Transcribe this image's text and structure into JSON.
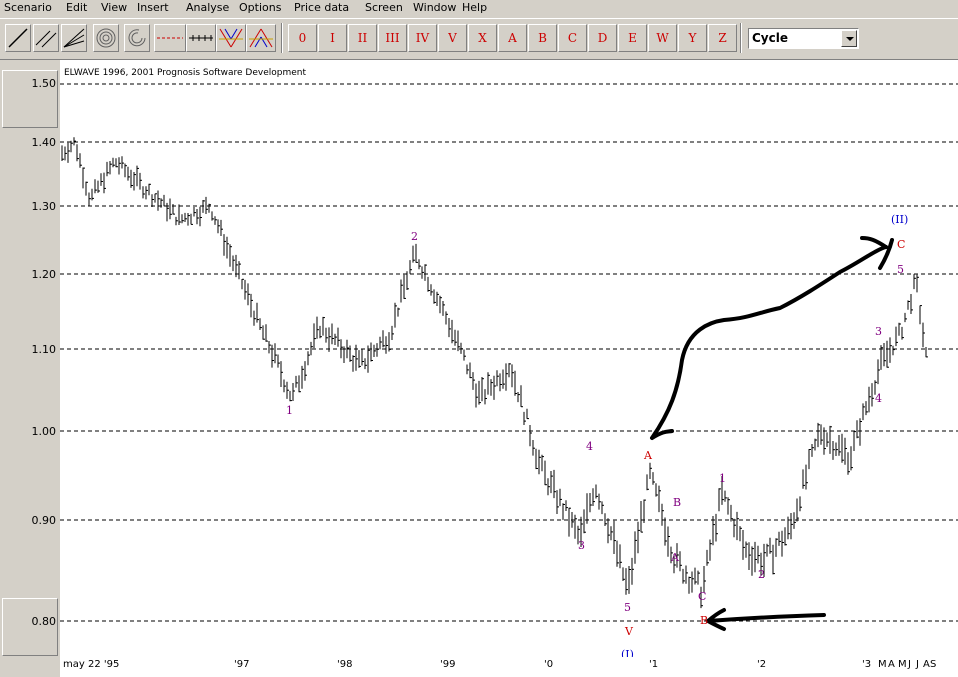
{
  "menu": [
    "Scenario",
    "Edit",
    "View",
    "Insert",
    "Analyse",
    "Options",
    "Price data",
    "Screen",
    "Window",
    "Help"
  ],
  "toolbar": {
    "wave_buttons": [
      "0",
      "I",
      "II",
      "III",
      "IV",
      "V",
      "X",
      "A",
      "B",
      "C",
      "D",
      "E",
      "W",
      "Y",
      "Z"
    ],
    "degree_select": "Cycle"
  },
  "chart": {
    "copyright": "ELWAVE   1996, 2001 Prognosis Software Development",
    "y_ticks": [
      "1.50",
      "1.40",
      "1.30",
      "1.20",
      "1.10",
      "1.00",
      "0.90",
      "0.80"
    ],
    "x_ticks": [
      "may 22 '95",
      "'97",
      "'98",
      "'99",
      "'0",
      "'1",
      "'2",
      "'3",
      "M",
      "A",
      "M",
      "J",
      "J",
      "A",
      "S"
    ],
    "wave_labels": {
      "w1": "1",
      "w2": "2",
      "w3a": "3",
      "w4a": "4",
      "w5a": "5",
      "V": "V",
      "I_paren": "(I)",
      "A": "A",
      "B_circ": "B",
      "A_circ": "A",
      "C_circ": "C",
      "B": "B",
      "c1": "1",
      "c2": "2",
      "c3": "3",
      "c4": "4",
      "c5": "5",
      "C": "C",
      "II_paren": "(II)"
    },
    "colors": {
      "circled": "#800080",
      "red": "#cc0000",
      "blue": "#0000cc",
      "annotation": "#000000"
    }
  },
  "chart_data": {
    "type": "bar",
    "title": "",
    "ylim": [
      0.77,
      1.53
    ],
    "grid": "horizontal dashed",
    "approx_path": [
      [
        0,
        1.38
      ],
      [
        15,
        1.4
      ],
      [
        30,
        1.31
      ],
      [
        55,
        1.37
      ],
      [
        90,
        1.32
      ],
      [
        120,
        1.28
      ],
      [
        150,
        1.3
      ],
      [
        175,
        1.21
      ],
      [
        200,
        1.13
      ],
      [
        232,
        1.04
      ],
      [
        260,
        1.13
      ],
      [
        300,
        1.08
      ],
      [
        330,
        1.12
      ],
      [
        355,
        1.23
      ],
      [
        380,
        1.16
      ],
      [
        420,
        1.04
      ],
      [
        450,
        1.08
      ],
      [
        480,
        0.96
      ],
      [
        520,
        0.88
      ],
      [
        535,
        0.94
      ],
      [
        568,
        0.83
      ],
      [
        590,
        0.95
      ],
      [
        615,
        0.86
      ],
      [
        642,
        0.83
      ],
      [
        662,
        0.93
      ],
      [
        685,
        0.87
      ],
      [
        705,
        0.86
      ],
      [
        730,
        0.89
      ],
      [
        760,
        1.0
      ],
      [
        790,
        0.97
      ],
      [
        820,
        1.08
      ],
      [
        840,
        1.12
      ],
      [
        856,
        1.19
      ],
      [
        866,
        1.09
      ]
    ]
  }
}
